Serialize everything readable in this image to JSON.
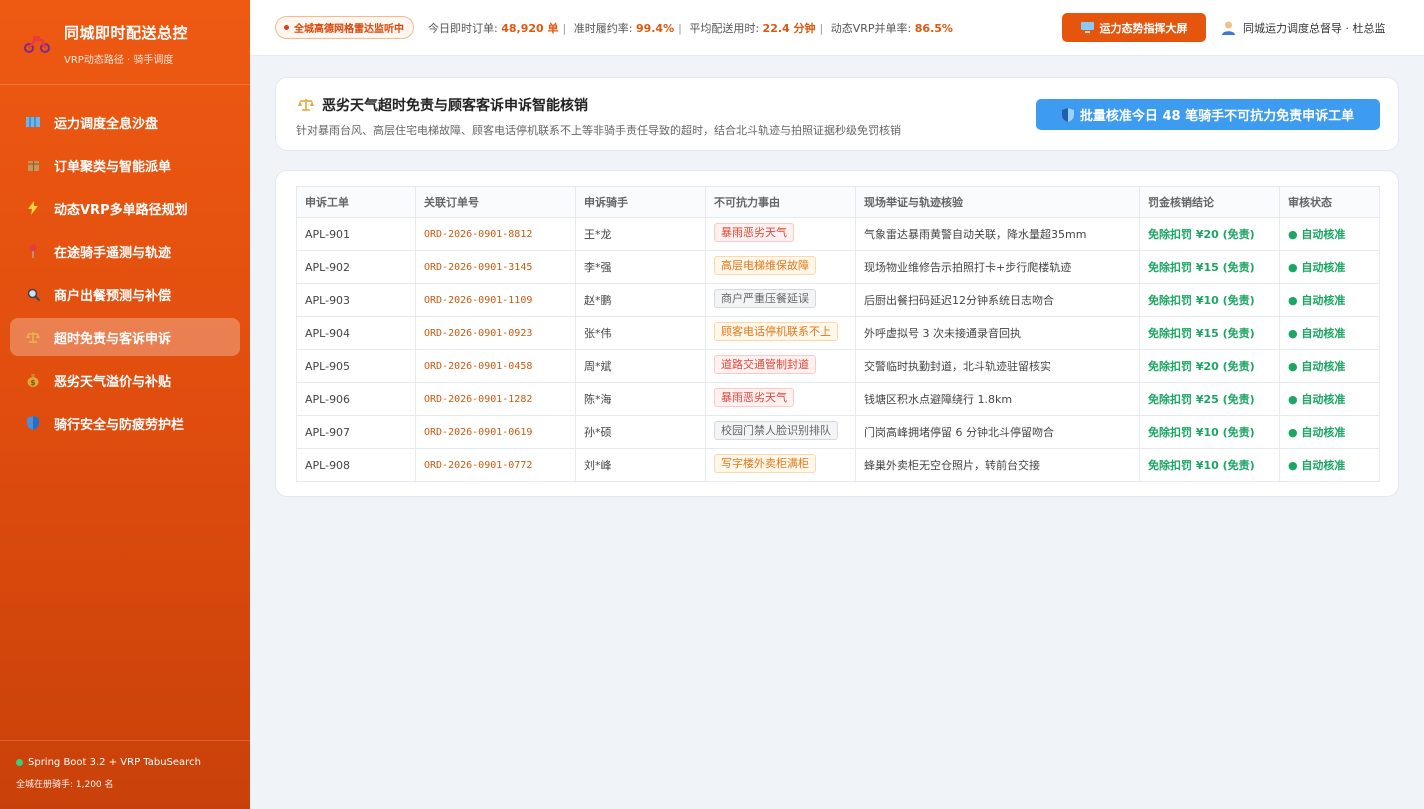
{
  "brand": {
    "title": "同城即时配送总控",
    "subtitle": "VRP动态路径 · 骑手调度"
  },
  "nav": [
    {
      "label": "运力调度全息沙盘",
      "icon": "map-icon"
    },
    {
      "label": "订单聚类与智能派单",
      "icon": "package-icon"
    },
    {
      "label": "动态VRP多单路径规划",
      "icon": "lightning-icon"
    },
    {
      "label": "在途骑手遥测与轨迹",
      "icon": "pin-icon"
    },
    {
      "label": "商户出餐预测与补偿",
      "icon": "magnifier-icon"
    },
    {
      "label": "超时免责与客诉申诉",
      "icon": "scale-icon",
      "active": true
    },
    {
      "label": "恶劣天气溢价与补贴",
      "icon": "money-bag-icon"
    },
    {
      "label": "骑行安全与防疲劳护栏",
      "icon": "shield-icon"
    }
  ],
  "footer": {
    "stack": "Spring Boot 3.2 + VRP TabuSearch",
    "riders": "全城在册骑手: 1,200 名"
  },
  "topbar": {
    "radar": "全城高德网格雷达监听中",
    "kpis": [
      {
        "label": "今日即时订单:",
        "value": "48,920 单"
      },
      {
        "label": "准时履约率:",
        "value": "99.4%"
      },
      {
        "label": "平均配送用时:",
        "value": "22.4 分钟"
      },
      {
        "label": "动态VRP并单率:",
        "value": "86.5%"
      }
    ],
    "screen_button": "运力态势指挥大屏",
    "user": "同城运力调度总督导 · 杜总监"
  },
  "header": {
    "title": "恶劣天气超时免责与顾客客诉申诉智能核销",
    "desc": "针对暴雨台风、高层住宅电梯故障、顾客电话停机联系不上等非骑手责任导致的超时，结合北斗轨迹与拍照证据秒级免罚核销",
    "batch_button": "批量核准今日 48 笔骑手不可抗力免责申诉工单"
  },
  "table": {
    "columns": [
      "申诉工单",
      "关联订单号",
      "申诉骑手",
      "不可抗力事由",
      "现场举证与轨迹核验",
      "罚金核销结论",
      "审核状态"
    ],
    "rows": [
      {
        "id": "APL-901",
        "order": "ORD-2026-0901-8812",
        "rider": "王*龙",
        "reason": "暴雨恶劣天气",
        "tag": "red",
        "evidence": "气象雷达暴雨黄警自动关联，降水量超35mm",
        "fine": "免除扣罚 ¥20 (免责)",
        "status": "● 自动核准"
      },
      {
        "id": "APL-902",
        "order": "ORD-2026-0901-3145",
        "rider": "李*强",
        "reason": "高层电梯维保故障",
        "tag": "orange",
        "evidence": "现场物业维修告示拍照打卡+步行爬楼轨迹",
        "fine": "免除扣罚 ¥15 (免责)",
        "status": "● 自动核准"
      },
      {
        "id": "APL-903",
        "order": "ORD-2026-0901-1109",
        "rider": "赵*鹏",
        "reason": "商户严重压餐延误",
        "tag": "gray",
        "evidence": "后厨出餐扫码延迟12分钟系统日志吻合",
        "fine": "免除扣罚 ¥10 (免责)",
        "status": "● 自动核准"
      },
      {
        "id": "APL-904",
        "order": "ORD-2026-0901-0923",
        "rider": "张*伟",
        "reason": "顾客电话停机联系不上",
        "tag": "orange",
        "evidence": "外呼虚拟号 3 次未接通录音回执",
        "fine": "免除扣罚 ¥15 (免责)",
        "status": "● 自动核准"
      },
      {
        "id": "APL-905",
        "order": "ORD-2026-0901-0458",
        "rider": "周*斌",
        "reason": "道路交通管制封道",
        "tag": "red",
        "evidence": "交警临时执勤封道，北斗轨迹驻留核实",
        "fine": "免除扣罚 ¥20 (免责)",
        "status": "● 自动核准"
      },
      {
        "id": "APL-906",
        "order": "ORD-2026-0901-1282",
        "rider": "陈*海",
        "reason": "暴雨恶劣天气",
        "tag": "red",
        "evidence": "钱塘区积水点避障绕行 1.8km",
        "fine": "免除扣罚 ¥25 (免责)",
        "status": "● 自动核准"
      },
      {
        "id": "APL-907",
        "order": "ORD-2026-0901-0619",
        "rider": "孙*硕",
        "reason": "校园门禁人脸识别排队",
        "tag": "gray",
        "evidence": "门岗高峰拥堵停留 6 分钟北斗停留吻合",
        "fine": "免除扣罚 ¥10 (免责)",
        "status": "● 自动核准"
      },
      {
        "id": "APL-908",
        "order": "ORD-2026-0901-0772",
        "rider": "刘*峰",
        "reason": "写字楼外卖柜满柜",
        "tag": "orange",
        "evidence": "蜂巢外卖柜无空仓照片，转前台交接",
        "fine": "免除扣罚 ¥10 (免责)",
        "status": "● 自动核准"
      }
    ]
  }
}
